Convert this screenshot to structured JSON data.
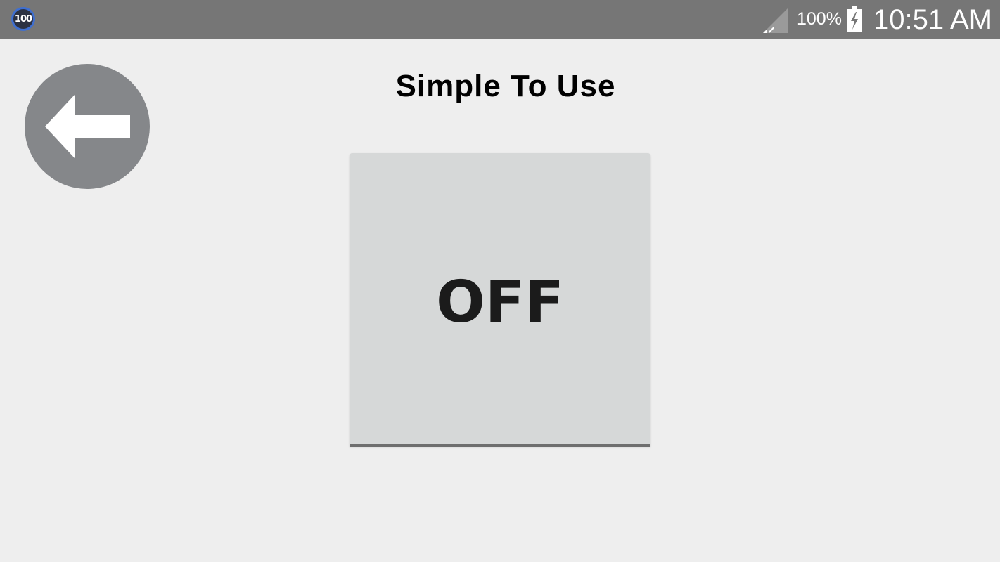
{
  "status_bar": {
    "notification_badge": "100",
    "signal_icon": "cell-signal-icon",
    "battery_percent": "100%",
    "battery_icon": "battery-charging-icon",
    "time": "10:51 AM"
  },
  "header": {
    "title": "Simple To Use",
    "back_icon": "arrow-left-icon"
  },
  "main": {
    "toggle_label": "OFF",
    "toggle_state": "off"
  },
  "colors": {
    "status_bar_bg": "#767676",
    "page_bg": "#eeeeee",
    "back_button_bg": "#85878a",
    "toggle_bg": "#d6d8d8",
    "toggle_text": "#1b1b1b"
  }
}
